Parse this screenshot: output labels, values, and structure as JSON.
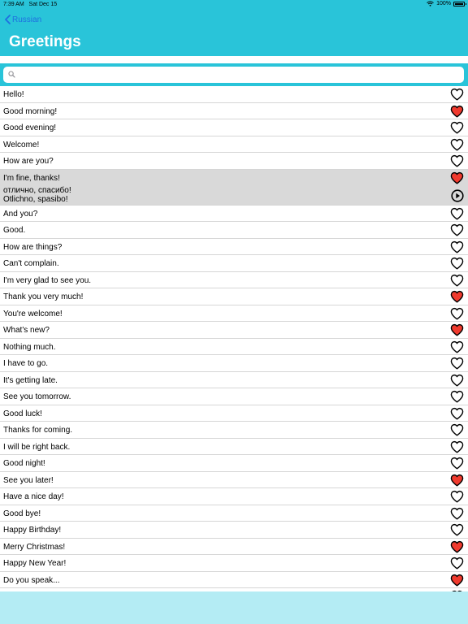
{
  "status": {
    "time": "7:39 AM",
    "date": "Sat Dec 15",
    "battery": "100%"
  },
  "nav": {
    "back_label": "Russian",
    "title": "Greetings"
  },
  "search": {
    "placeholder": "",
    "value": ""
  },
  "colors": {
    "header": "#29c4d9",
    "back": "#1f6fe0",
    "heart_on": "#f03a2e",
    "selected_row": "#d9d9d9",
    "footer": "#b4ecf4"
  },
  "phrases": [
    {
      "text": "Hello!",
      "fav": false
    },
    {
      "text": "Good morning!",
      "fav": true
    },
    {
      "text": "Good evening!",
      "fav": false
    },
    {
      "text": "Welcome!",
      "fav": false
    },
    {
      "text": "How are you?",
      "fav": false
    },
    {
      "text": "I'm fine, thanks!",
      "fav": true,
      "expanded": true,
      "translation": "отлично, спасибо!",
      "transliteration": "Otlichno, spasibo!"
    },
    {
      "text": "And you?",
      "fav": false
    },
    {
      "text": "Good.",
      "fav": false
    },
    {
      "text": "How are things?",
      "fav": false
    },
    {
      "text": "Can't complain.",
      "fav": false
    },
    {
      "text": "I'm very glad to see you.",
      "fav": false
    },
    {
      "text": "Thank you very much!",
      "fav": true
    },
    {
      "text": "You're welcome!",
      "fav": false
    },
    {
      "text": "What's new?",
      "fav": true
    },
    {
      "text": "Nothing much.",
      "fav": false
    },
    {
      "text": "I have to go.",
      "fav": false
    },
    {
      "text": "It's getting late.",
      "fav": false
    },
    {
      "text": "See you tomorrow.",
      "fav": false
    },
    {
      "text": "Good luck!",
      "fav": false
    },
    {
      "text": "Thanks for coming.",
      "fav": false
    },
    {
      "text": "I will be right back.",
      "fav": false
    },
    {
      "text": "Good night!",
      "fav": false
    },
    {
      "text": "See you later!",
      "fav": true
    },
    {
      "text": "Have a nice day!",
      "fav": false
    },
    {
      "text": "Good bye!",
      "fav": false
    },
    {
      "text": "Happy Birthday!",
      "fav": false
    },
    {
      "text": "Merry Christmas!",
      "fav": true
    },
    {
      "text": "Happy New Year!",
      "fav": false
    },
    {
      "text": "Do you speak...",
      "fav": true
    },
    {
      "text": "",
      "fav": false
    }
  ]
}
